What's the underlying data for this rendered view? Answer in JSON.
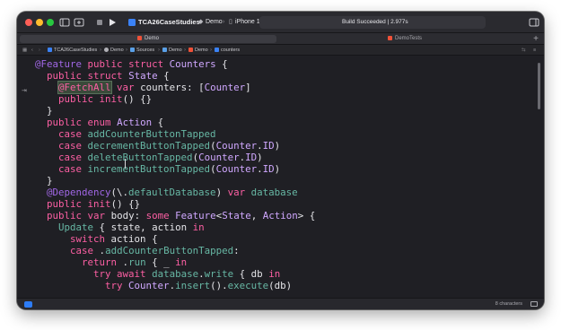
{
  "toolbar": {
    "project_name": "TCA26CaseStudies",
    "scheme": "Demo",
    "destination": "iPhone 17 Pro (26.2)",
    "status": "Build Succeeded | 2.977s",
    "icons": [
      "sidebar-icon",
      "add-icon",
      "stop-icon",
      "run-icon",
      "inspector-icon"
    ]
  },
  "tabs": [
    {
      "label": "Demo",
      "active": true
    },
    {
      "label": "DemoTests",
      "active": false
    }
  ],
  "jumpbar": {
    "items": [
      "TCA26CaseStudies",
      "Demo",
      "Sources",
      "Demo",
      "Demo",
      "counters"
    ]
  },
  "editor": {
    "lines": [
      "@Feature public struct Counters {",
      "  public struct State {",
      "    @FetchAll var counters: [Counter]",
      "    public init() {}",
      "  }",
      "  public enum Action {",
      "    case addCounterButtonTapped",
      "    case decrementButtonTapped(Counter.ID)",
      "    case deleteButtonTapped(Counter.ID)",
      "    case incrementButtonTapped(Counter.ID)",
      "  }",
      "  @Dependency(\\.defaultDatabase) var database",
      "  public init() {}",
      "  public var body: some Feature<State, Action> {",
      "    Update { state, action in",
      "      switch action {",
      "      case .addCounterButtonTapped:",
      "        return .run { _ in",
      "          try await database.write { db in",
      "            try Counter.insert().execute(db)"
    ]
  },
  "statusbar": {
    "characters": "8 characters"
  },
  "colors": {
    "keyword": "#fc5fa3",
    "type": "#d0a8ff",
    "function": "#67b7a4",
    "case": "#a167e6",
    "accent": "#2d7cf6"
  }
}
